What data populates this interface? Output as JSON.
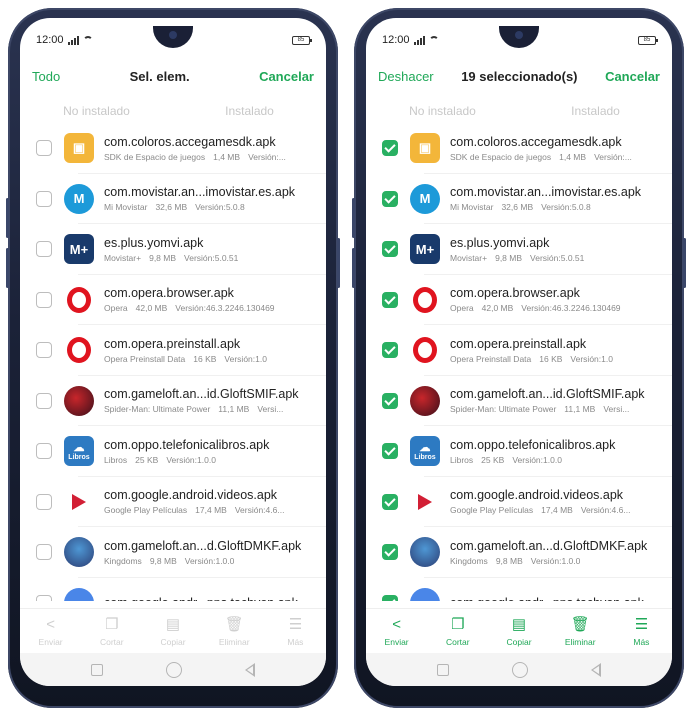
{
  "status": {
    "time": "12:00",
    "battery": "85"
  },
  "left": {
    "action_left": "Todo",
    "title": "Sel. elem.",
    "action_right": "Cancelar",
    "tabs": [
      "No instalado",
      "Instalado"
    ],
    "checked": false,
    "bottom_state": "disabled"
  },
  "right": {
    "action_left": "Deshacer",
    "title": "19 seleccionado(s)",
    "action_right": "Cancelar",
    "tabs": [
      "No instalado",
      "Instalado"
    ],
    "checked": true,
    "bottom_state": "enabled"
  },
  "apps": [
    {
      "name": "com.coloros.accegamesdk.apk",
      "label": "SDK de Espacio de juegos",
      "size": "1,4 MB",
      "version": "Versión:...",
      "icon": "games-icon"
    },
    {
      "name": "com.movistar.an...imovistar.es.apk",
      "label": "Mi Movistar",
      "size": "32,6 MB",
      "version": "Versión:5.0.8",
      "icon": "movistar-icon"
    },
    {
      "name": "es.plus.yomvi.apk",
      "label": "Movistar+",
      "size": "9,8 MB",
      "version": "Versión:5.0.51",
      "icon": "movistar-plus-icon"
    },
    {
      "name": "com.opera.browser.apk",
      "label": "Opera",
      "size": "42,0 MB",
      "version": "Versión:46.3.2246.130469",
      "icon": "opera-icon"
    },
    {
      "name": "com.opera.preinstall.apk",
      "label": "Opera Preinstall Data",
      "size": "16 KB",
      "version": "Versión:1.0",
      "icon": "opera-icon"
    },
    {
      "name": "com.gameloft.an...id.GloftSMIF.apk",
      "label": "Spider-Man: Ultimate Power",
      "size": "11,1 MB",
      "version": "Versi...",
      "icon": "spiderman-icon"
    },
    {
      "name": "com.oppo.telefonicalibros.apk",
      "label": "Libros",
      "size": "25 KB",
      "version": "Versión:1.0.0",
      "icon": "libros-icon"
    },
    {
      "name": "com.google.android.videos.apk",
      "label": "Google Play Películas",
      "size": "17,4 MB",
      "version": "Versión:4.6...",
      "icon": "play-movies-icon"
    },
    {
      "name": "com.gameloft.an...d.GloftDMKF.apk",
      "label": "Kingdoms",
      "size": "9,8 MB",
      "version": "Versión:1.0.0",
      "icon": "kingdoms-icon"
    },
    {
      "name": "com.google.andr...pps.tachyon.apk",
      "label": "",
      "size": "",
      "version": "",
      "icon": "duo-icon"
    }
  ],
  "bottom_actions": [
    {
      "label": "Enviar",
      "icon": "share-icon",
      "glyph": "<"
    },
    {
      "label": "Cortar",
      "icon": "cut-icon",
      "glyph": "❐"
    },
    {
      "label": "Copiar",
      "icon": "copy-icon",
      "glyph": "▤"
    },
    {
      "label": "Eliminar",
      "icon": "trash-icon",
      "glyph": "🗑"
    },
    {
      "label": "Más",
      "icon": "more-icon",
      "glyph": "☰"
    }
  ],
  "libros_icon_text": "Libros",
  "plus_icon_text": "M+",
  "colors": {
    "accent": "#20a858",
    "check": "#29b062"
  }
}
